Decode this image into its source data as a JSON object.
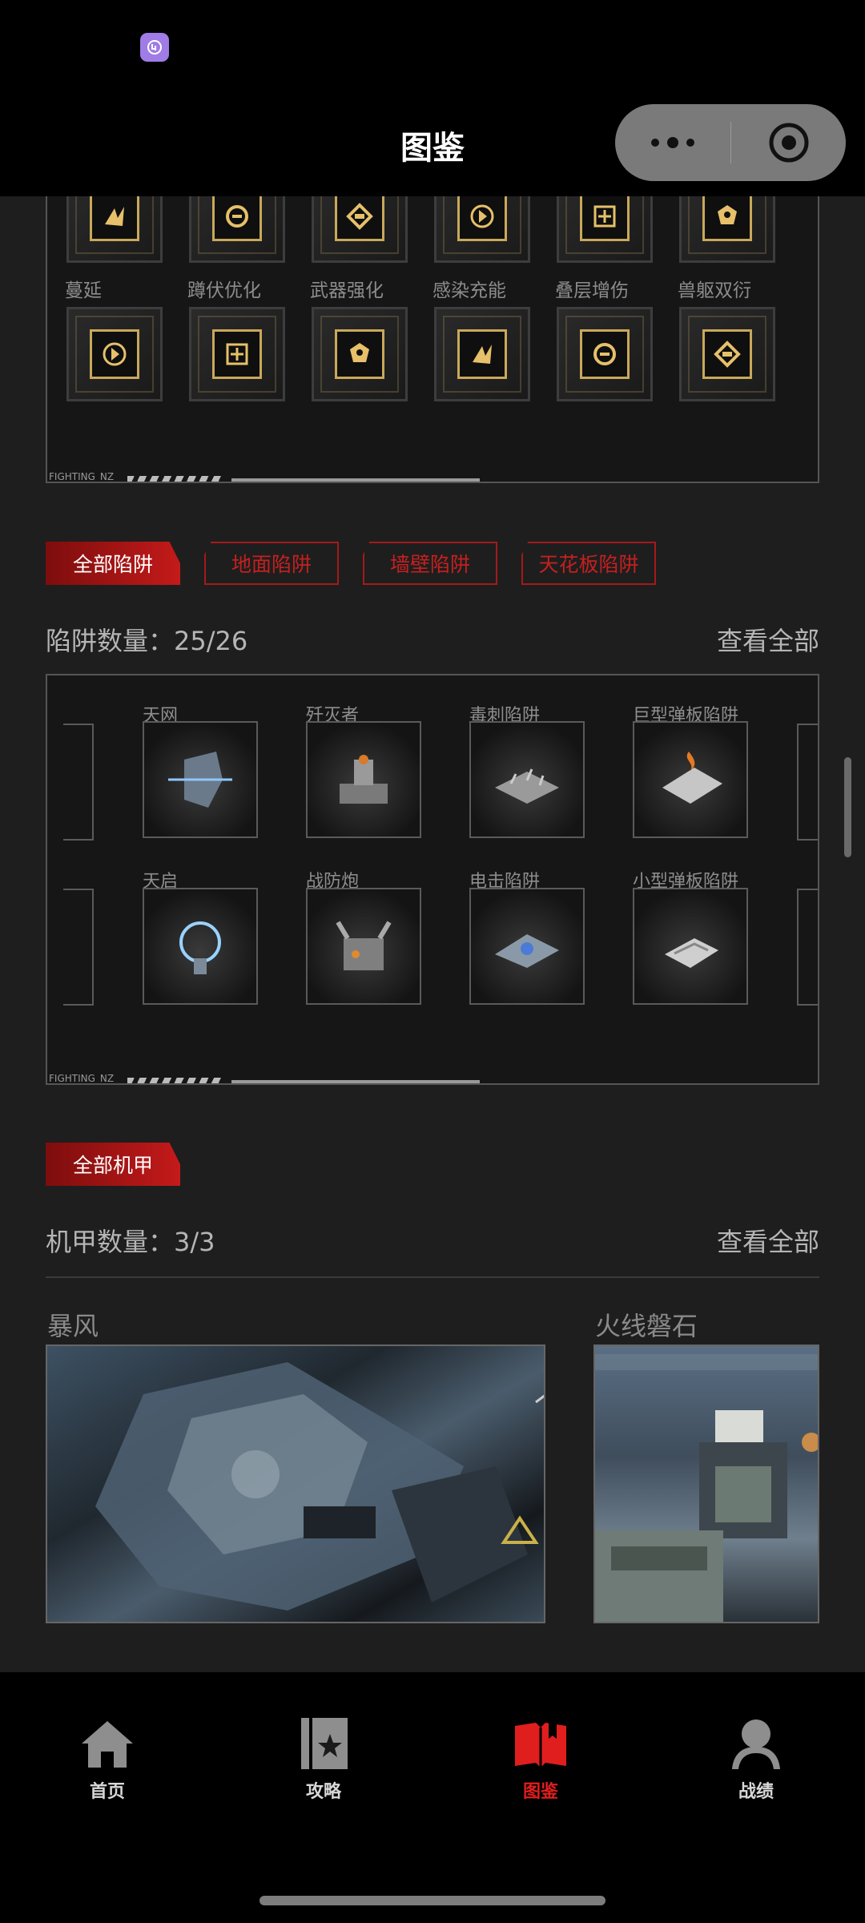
{
  "window": {
    "title": "图鉴"
  },
  "skills": {
    "row1_labels": [],
    "row2_labels": [
      "蔓延",
      "蹲伏优化",
      "武器强化",
      "感染充能",
      "叠层增伤",
      "兽躯双衍"
    ],
    "frame_tag": "FIGHTING_NZ"
  },
  "traps": {
    "filters": [
      "全部陷阱",
      "地面陷阱",
      "墙壁陷阱",
      "天花板陷阱"
    ],
    "count_label": "陷阱数量：25/26",
    "view_all": "查看全部",
    "row1": [
      "天网",
      "歼灭者",
      "毒刺陷阱",
      "巨型弹板陷阱"
    ],
    "row2": [
      "天启",
      "战防炮",
      "电击陷阱",
      "小型弹板陷阱"
    ],
    "frame_tag": "FIGHTING_NZ"
  },
  "mechs": {
    "filter": "全部机甲",
    "count_label": "机甲数量：3/3",
    "view_all": "查看全部",
    "items": [
      "暴风",
      "火线磐石"
    ]
  },
  "tabbar": {
    "items": [
      "首页",
      "攻略",
      "图鉴",
      "战绩"
    ],
    "active": "图鉴",
    "active_color": "#e01e1e"
  }
}
